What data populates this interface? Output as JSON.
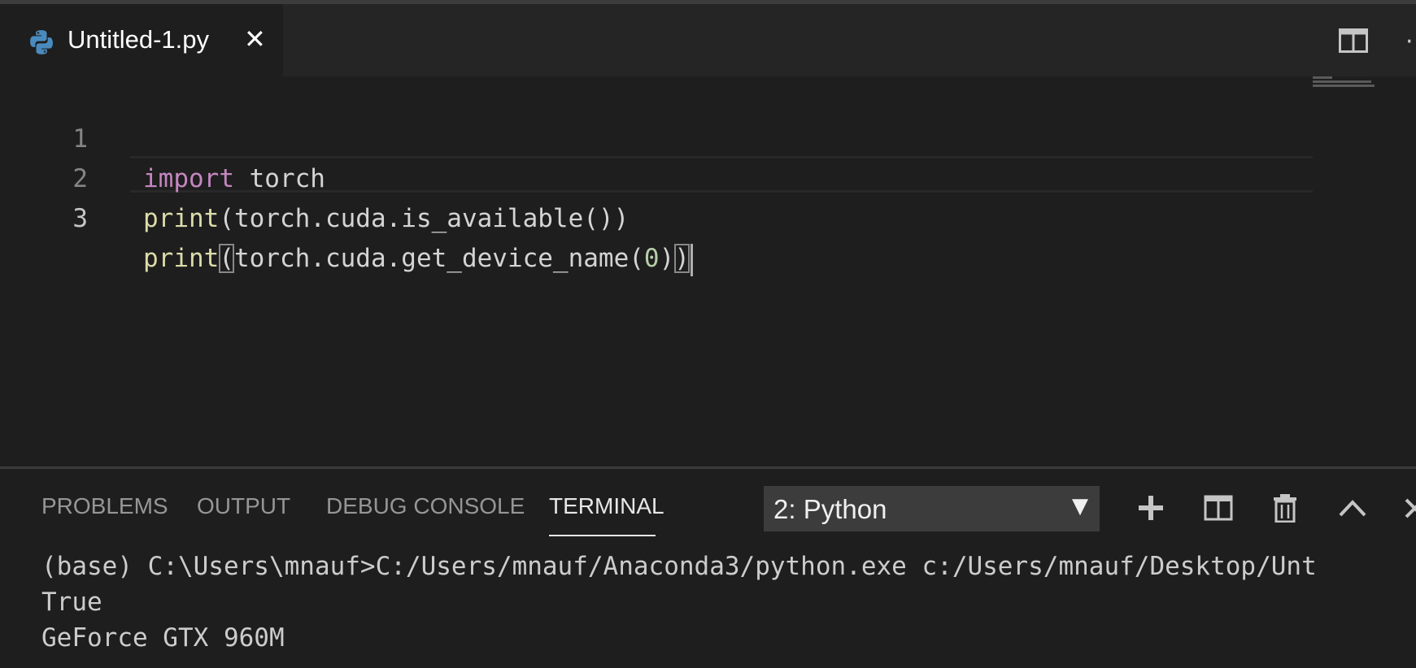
{
  "tab": {
    "filename": "Untitled-1.py",
    "close_glyph": "✕",
    "icon": "python-icon"
  },
  "editor_actions": {
    "split_icon": "split-editor-icon",
    "more_glyph": "·"
  },
  "editor": {
    "lines": [
      {
        "number": "1",
        "t1": "import",
        "t2": " torch"
      },
      {
        "number": "2",
        "t1": "print",
        "t2": "(torch.cuda.is_available())"
      },
      {
        "number": "3",
        "t1": "print",
        "t2": "(",
        "t3": "torch.cuda.get_device_name(",
        "t4": "0",
        "t5": ")",
        "t6": ")"
      }
    ]
  },
  "panel": {
    "tabs": {
      "problems": "PROBLEMS",
      "output": "OUTPUT",
      "debug_console": "DEBUG CONSOLE",
      "terminal": "TERMINAL"
    },
    "active_tab": "TERMINAL",
    "terminal_selector": {
      "value": "2: Python",
      "arrow": "▼"
    },
    "terminal_output": [
      "(base) C:\\Users\\mnauf>C:/Users/mnauf/Anaconda3/python.exe c:/Users/mnauf/Desktop/Unt",
      "True",
      "GeForce GTX 960M"
    ]
  },
  "colors": {
    "background": "#1e1e1e",
    "tabbar": "#252526",
    "keyword": "#c586c0",
    "function": "#dcdcaa",
    "number": "#b5cea8",
    "text": "#d4d4d4",
    "python_blue": "#4a8bbf"
  }
}
